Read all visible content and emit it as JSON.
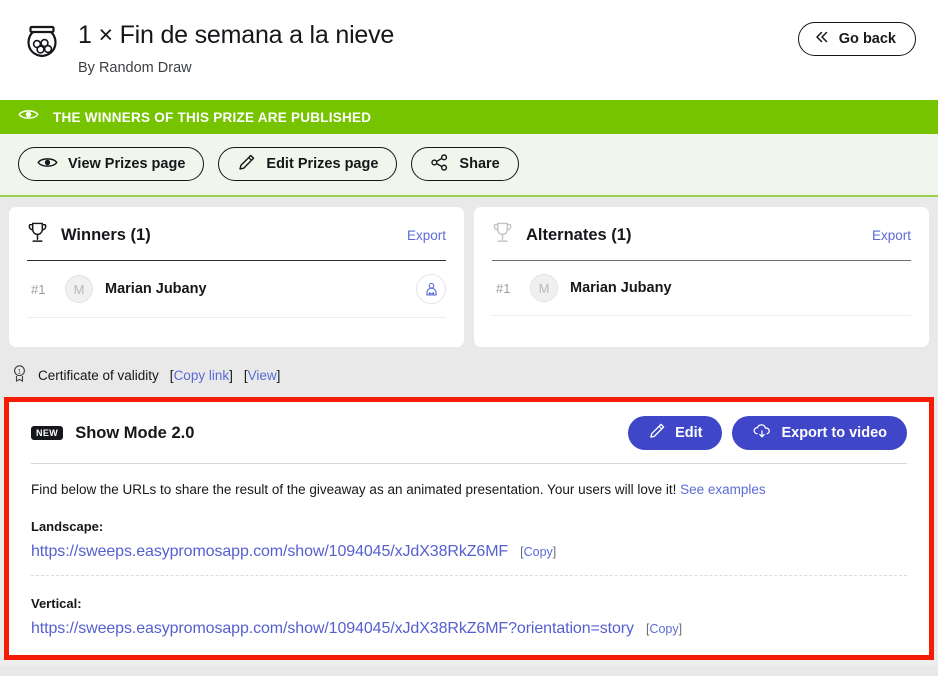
{
  "header": {
    "prize_icon": "raffle-jar-icon",
    "title": "1 × Fin de semana a la nieve",
    "subtitle": "By Random Draw",
    "go_back_label": "Go back",
    "go_back_icon": "double-chevron-left-icon"
  },
  "published_banner": {
    "icon": "eye-icon",
    "text": "THE WINNERS OF THIS PRIZE ARE PUBLISHED",
    "background_color": "#76c400",
    "text_color": "#ffffff"
  },
  "actions": [
    {
      "label": "View Prizes page",
      "icon": "eye-icon"
    },
    {
      "label": "Edit Prizes page",
      "icon": "pencil-icon"
    },
    {
      "label": "Share",
      "icon": "share-nodes-icon"
    }
  ],
  "winners_panel": {
    "icon": "trophy-icon",
    "title": "Winners (1)",
    "export_label": "Export",
    "rows": [
      {
        "rank": "#1",
        "initial": "M",
        "name": "Marian Jubany",
        "action_icon": "swap-participant-icon"
      }
    ]
  },
  "alternates_panel": {
    "icon": "trophy-icon",
    "title": "Alternates (1)",
    "export_label": "Export",
    "rows": [
      {
        "rank": "#1",
        "initial": "M",
        "name": "Marian Jubany"
      }
    ]
  },
  "certificate": {
    "icon": "award-seal-icon",
    "label": "Certificate of validity",
    "copy_link_label": "Copy link",
    "view_label": "View",
    "open_bracket": "[",
    "close_bracket": "]"
  },
  "show_mode": {
    "badge": "NEW",
    "title": "Show Mode 2.0",
    "edit_label": "Edit",
    "edit_icon": "pencil-icon",
    "export_video_label": "Export to video",
    "export_video_icon": "cloud-download-icon",
    "description": "Find below the URLs to share the result of the giveaway as an animated presentation. Your users will love it!",
    "see_examples_label": "See examples",
    "landscape_label": "Landscape:",
    "landscape_url": "https://sweeps.easypromosapp.com/show/1094045/xJdX38RkZ6MF",
    "landscape_copy_label": "Copy",
    "vertical_label": "Vertical:",
    "vertical_url": "https://sweeps.easypromosapp.com/show/1094045/xJdX38RkZ6MF?orientation=story",
    "vertical_copy_label": "Copy",
    "highlight_color": "#f41c05",
    "button_color": "#3f46c8"
  }
}
